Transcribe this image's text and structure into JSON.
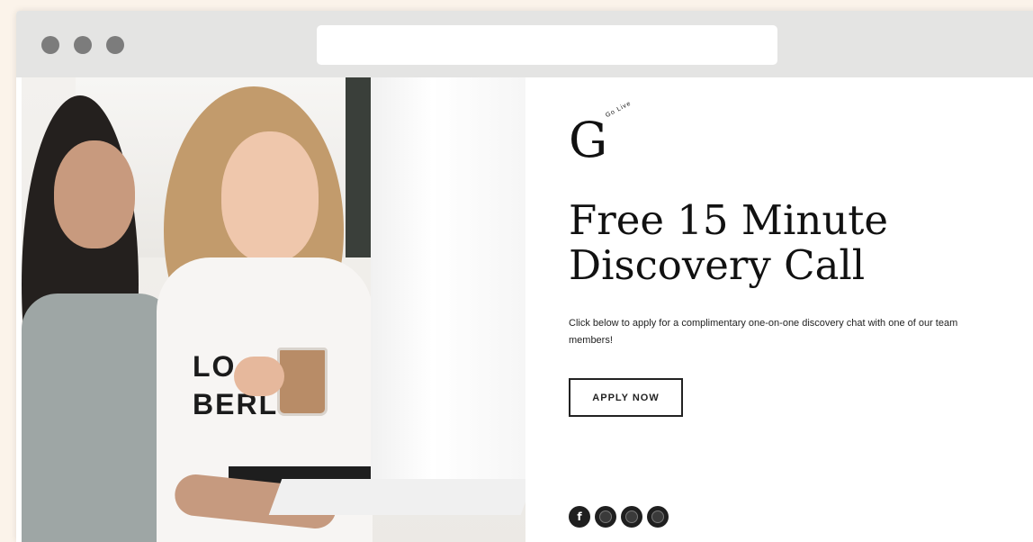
{
  "browser": {
    "window_controls": [
      "dot",
      "dot",
      "dot"
    ],
    "address_bar": {
      "value": ""
    }
  },
  "hero": {
    "logo": {
      "letter": "G",
      "tagline": "Go Live"
    },
    "title": "Free 15 Minute\nDiscovery Call",
    "description": "Click below to apply for a complimentary one-on-one discovery chat with one of our team members!",
    "cta_label": "APPLY NOW",
    "photo": {
      "shirt_text": "LONDON BERLIN",
      "shirt_lines": [
        "LO",
        "BERLIN"
      ]
    }
  },
  "social": [
    {
      "icon": "facebook-icon",
      "glyph": "f"
    },
    {
      "icon": "instagram-icon",
      "glyph": ""
    },
    {
      "icon": "pinterest-icon",
      "glyph": ""
    },
    {
      "icon": "youtube-icon",
      "glyph": ""
    }
  ]
}
